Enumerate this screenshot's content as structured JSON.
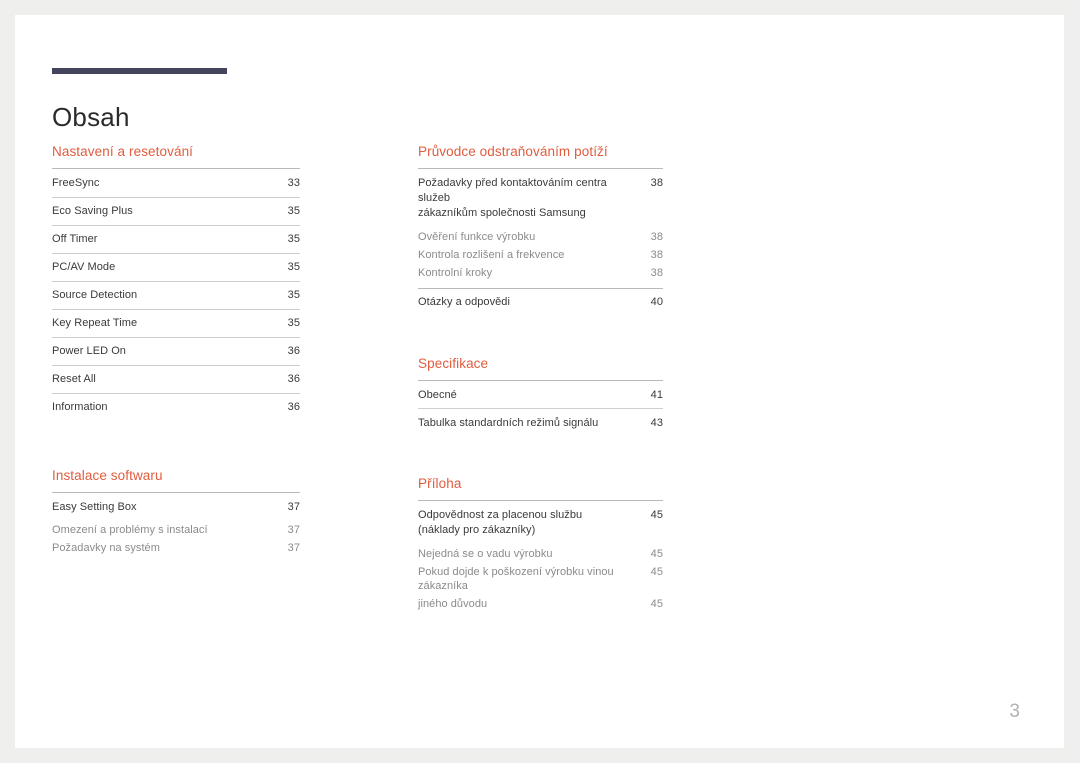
{
  "document": {
    "title": "Obsah",
    "page_number": "3",
    "accent_color": "#e05c3f",
    "rule_color": "#44445c",
    "folio_color": "#b0b0b6"
  },
  "columns": {
    "left": [
      {
        "heading": "Nastavení a resetování",
        "entries": [
          {
            "label": "FreeSync",
            "page": "33",
            "level": "top"
          },
          {
            "label": "Eco Saving Plus",
            "page": "35",
            "level": "top"
          },
          {
            "label": "Off Timer",
            "page": "35",
            "level": "top"
          },
          {
            "label": "PC/AV Mode",
            "page": "35",
            "level": "top"
          },
          {
            "label": "Source Detection",
            "page": "35",
            "level": "top"
          },
          {
            "label": "Key Repeat Time",
            "page": "35",
            "level": "top"
          },
          {
            "label": "Power LED On",
            "page": "36",
            "level": "top"
          },
          {
            "label": "Reset All",
            "page": "36",
            "level": "top"
          },
          {
            "label": "Information",
            "page": "36",
            "level": "top"
          }
        ]
      },
      {
        "heading": "Instalace softwaru",
        "entries": [
          {
            "label": "Easy Setting Box",
            "page": "37",
            "level": "top"
          },
          {
            "label": "Omezení a problémy s instalací",
            "page": "37",
            "level": "sub"
          },
          {
            "label": "Požadavky na systém",
            "page": "37",
            "level": "sub"
          }
        ]
      }
    ],
    "right": [
      {
        "heading": "Průvodce odstraňováním potíží",
        "entries": [
          {
            "label": "Požadavky před kontaktováním centra služeb\nzákazníkům společnosti Samsung",
            "page": "38",
            "level": "top"
          },
          {
            "label": "Ověření funkce výrobku",
            "page": "38",
            "level": "sub"
          },
          {
            "label": "Kontrola rozlišení a frekvence",
            "page": "38",
            "level": "sub"
          },
          {
            "label": "Kontrolní kroky",
            "page": "38",
            "level": "sub"
          },
          {
            "label": "Otázky a odpovědi",
            "page": "40",
            "level": "top-ruled"
          }
        ]
      },
      {
        "heading": "Specifikace",
        "entries": [
          {
            "label": "Obecné",
            "page": "41",
            "level": "top"
          },
          {
            "label": "Tabulka standardních režimů signálu",
            "page": "43",
            "level": "top"
          }
        ]
      },
      {
        "heading": "Příloha",
        "entries": [
          {
            "label": "Odpovědnost za placenou službu\n(náklady pro zákazníky)",
            "page": "45",
            "level": "top"
          },
          {
            "label": "Nejedná se o vadu výrobku",
            "page": "45",
            "level": "sub"
          },
          {
            "label": "Pokud dojde k poškození výrobku vinou zákazníka",
            "page": "45",
            "level": "sub"
          },
          {
            "label": "jiného důvodu",
            "page": "45",
            "level": "sub"
          }
        ]
      }
    ]
  }
}
